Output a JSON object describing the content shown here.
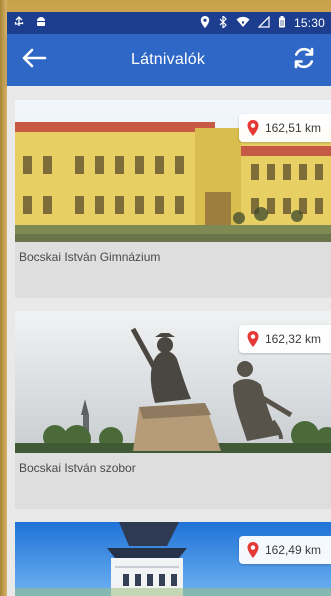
{
  "statusbar": {
    "time": "15:30"
  },
  "appbar": {
    "title": "Látnivalók"
  },
  "cards": [
    {
      "title": "Bocskai István Gimnázium",
      "distance": "162,51 km"
    },
    {
      "title": "Bocskai István szobor",
      "distance": "162,32 km"
    },
    {
      "title": "",
      "distance": "162,49 km"
    }
  ],
  "colors": {
    "statusbar": "#1d3e8e",
    "appbar": "#2f67c6",
    "pin": "#e53935"
  }
}
